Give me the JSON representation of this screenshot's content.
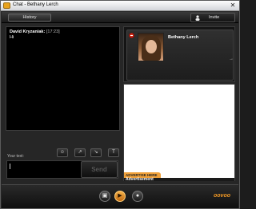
{
  "window": {
    "title": "Chat - Bethany Lerch",
    "close_glyph": "✕"
  },
  "toolbar": {
    "history_label": "History",
    "invite_label": "Invite"
  },
  "chat": {
    "messages": [
      {
        "sender": "David Kryzaniak:",
        "time": "[17:23]",
        "text": "Hi"
      }
    ]
  },
  "contact": {
    "name": "Bethany Lerch",
    "arrow_glyph": "→"
  },
  "ad": {
    "tab_label": "ADVERTISE HERE",
    "label": "Advertisement"
  },
  "composer": {
    "label": "Your text:",
    "send_label": "Send",
    "emotes": [
      {
        "name": "smiley-icon",
        "glyph": "☺"
      },
      {
        "name": "nudge-icon",
        "glyph": "↗"
      },
      {
        "name": "wink-icon",
        "glyph": "↘"
      },
      {
        "name": "text-format-icon",
        "glyph": "T"
      }
    ]
  },
  "bottom": {
    "icons": [
      {
        "name": "camera-icon",
        "glyph": "▣"
      },
      {
        "name": "video-chat-icon",
        "glyph": "▶"
      },
      {
        "name": "mic-icon",
        "glyph": "●"
      }
    ],
    "brand": "oovoo"
  },
  "colors": {
    "accent": "#f39a25",
    "remove": "#d82c1c",
    "ad_tab": "#f0a13a"
  }
}
